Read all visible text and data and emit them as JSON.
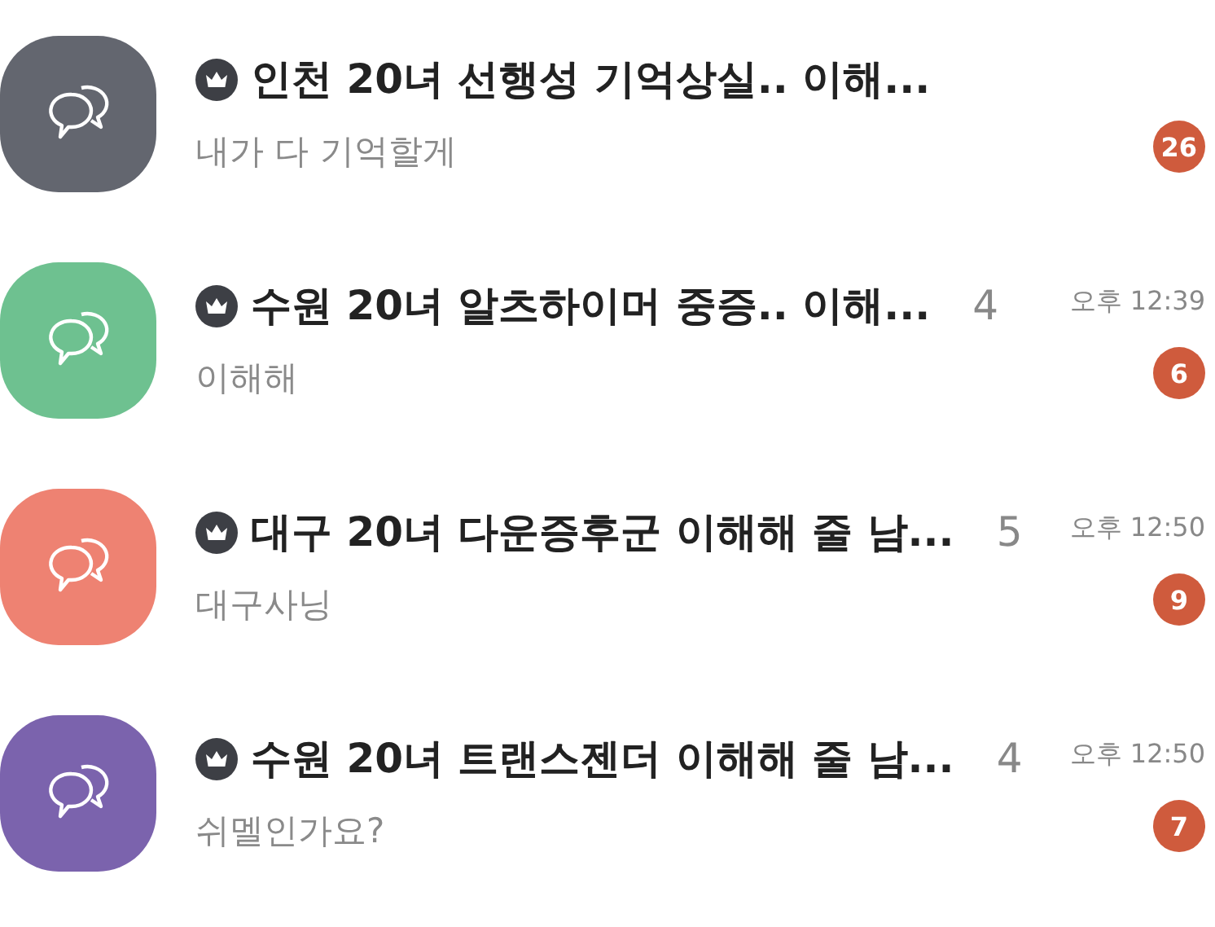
{
  "chats": [
    {
      "color": "#63666f",
      "title": "인천 20녀 선행성 기억상실.. 이해...",
      "last_message": "내가 다 기억할게",
      "unread": "26"
    },
    {
      "color": "#6ec190",
      "title": "수원 20녀 알츠하이머 중증.. 이해...",
      "members": "4",
      "time": "오후 12:39",
      "last_message": "이해해",
      "unread": "6"
    },
    {
      "color": "#ee8272",
      "title": "대구 20녀 다운증후군 이해해 줄 남...",
      "members": "5",
      "time": "오후 12:50",
      "last_message": "대구사닝",
      "unread": "9"
    },
    {
      "color": "#7b63ad",
      "title": "수원 20녀 트랜스젠더 이해해 줄 남...",
      "members": "4",
      "time": "오후 12:50",
      "last_message": "쉬멜인가요?",
      "unread": "7"
    }
  ]
}
